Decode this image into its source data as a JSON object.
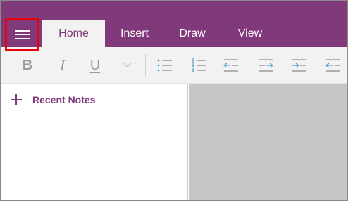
{
  "app": {
    "accent_color": "#80397b",
    "highlight_color": "#e8000b"
  },
  "nav": {
    "menu_icon": "hamburger-icon"
  },
  "tabs": [
    {
      "label": "Home",
      "active": true
    },
    {
      "label": "Insert",
      "active": false
    },
    {
      "label": "Draw",
      "active": false
    },
    {
      "label": "View",
      "active": false
    }
  ],
  "toolbar": {
    "bold_label": "B",
    "italic_label": "I",
    "underline_label": "U",
    "icons": [
      "chevron-down-icon",
      "bulleted-list-icon",
      "numbered-list-icon",
      "outdent-icon",
      "indent-icon",
      "indent-icon",
      "align-icon"
    ]
  },
  "pane": {
    "recent_notes_label": "Recent Notes",
    "recent_notes_icon": "plus-icon"
  }
}
